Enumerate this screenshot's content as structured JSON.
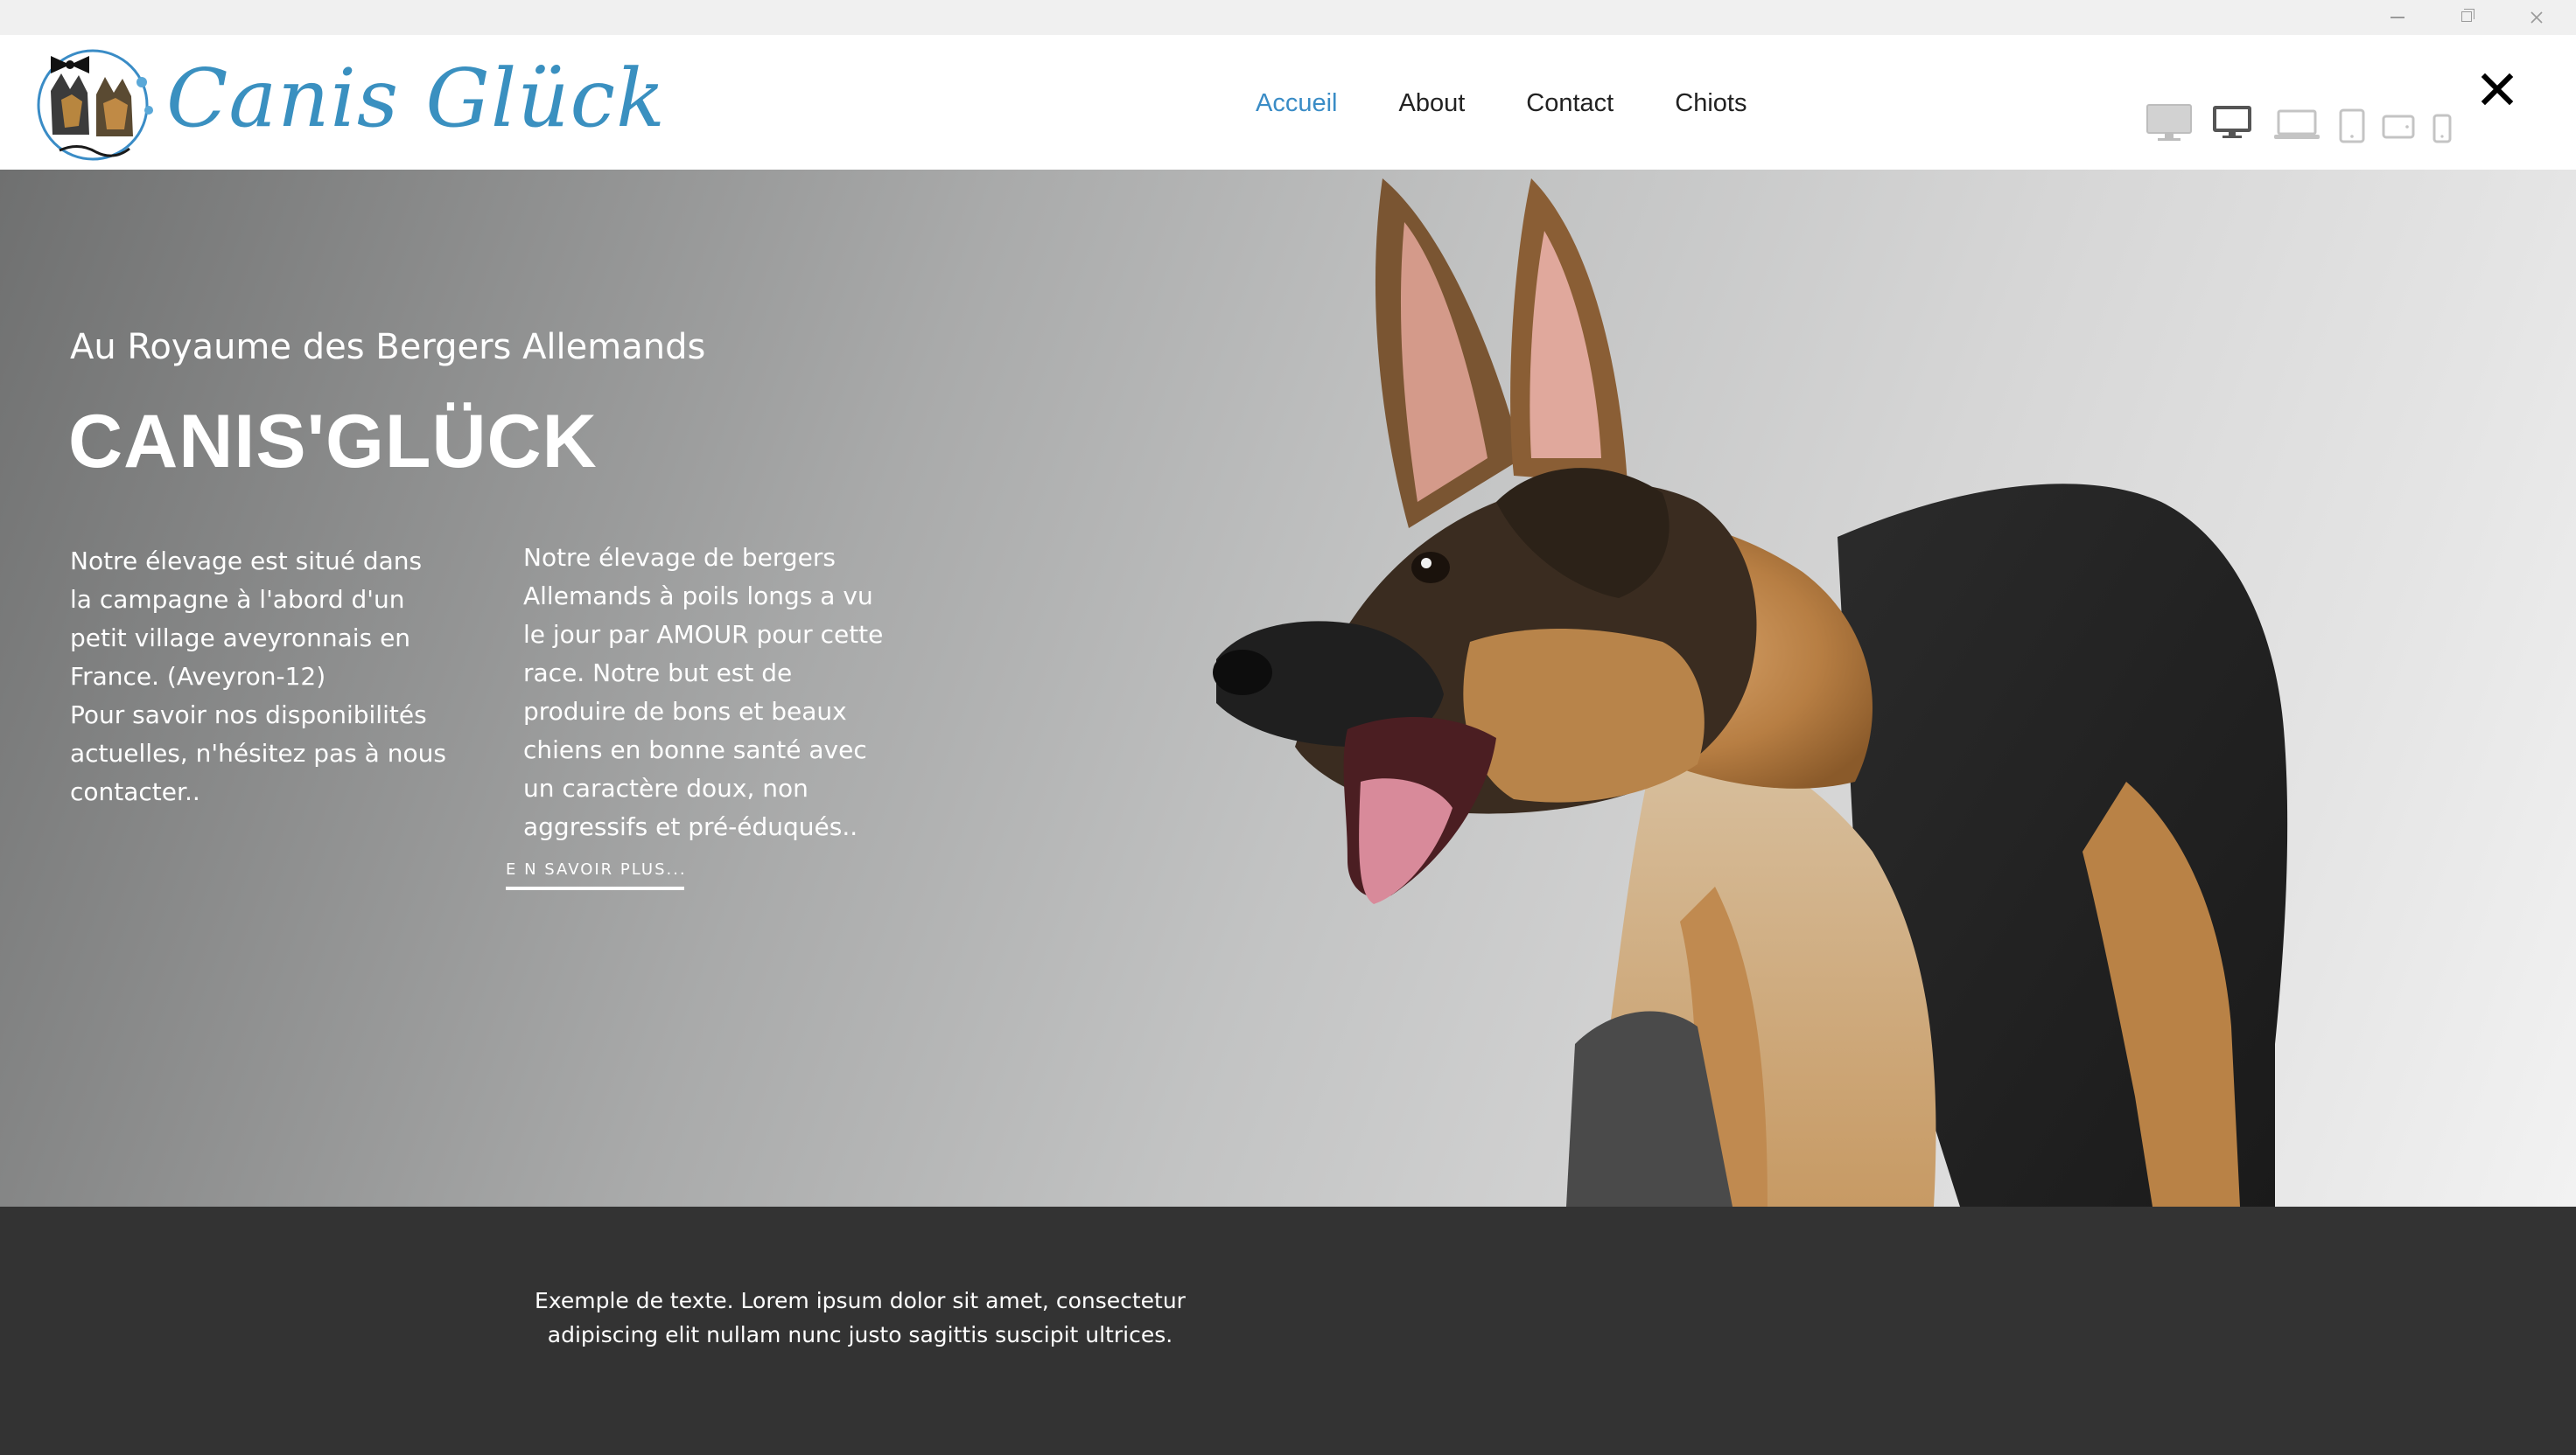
{
  "window": {
    "controls": [
      "minimize-icon",
      "restore-icon",
      "close-icon"
    ]
  },
  "header": {
    "brand": "Canis Glück",
    "nav": [
      {
        "label": "Accueil",
        "active": true
      },
      {
        "label": "About",
        "active": false
      },
      {
        "label": "Contact",
        "active": false
      },
      {
        "label": "Chiots",
        "active": false
      }
    ],
    "device_previews": [
      "desktop-large-icon",
      "desktop-icon",
      "laptop-icon",
      "tablet-portrait-icon",
      "tablet-landscape-icon",
      "phone-icon"
    ],
    "active_device": "desktop-icon"
  },
  "hero": {
    "subtitle": "Au Royaume des Bergers Allemands",
    "title": "CANIS'GLÜCK",
    "column_1": "Notre élevage est situé dans\nla campagne à l'abord d'un\npetit village aveyronnais en\nFrance. (Aveyron-12)\nPour savoir nos disponibilités\nactuelles, n'hésitez pas à nous\ncontacter..",
    "column_2": "Notre élevage de bergers\nAllemands à poils longs a vu\nle jour par AMOUR pour cette\nrace. Notre but est de\nproduire de bons et beaux\nchiens en bonne santé avec\nun caractère doux, non\naggressifs et pré-éduqués..",
    "read_more": "E N SAVOIR PLUS..."
  },
  "footer": {
    "text": "Exemple de texte. Lorem ipsum dolor sit amet, consectetur adipiscing elit nullam nunc justo sagittis suscipit ultrices."
  },
  "colors": {
    "accent": "#3a8cc6",
    "brand_text": "#3a90c0",
    "footer_bg": "#333333",
    "text_dark": "#222222"
  }
}
